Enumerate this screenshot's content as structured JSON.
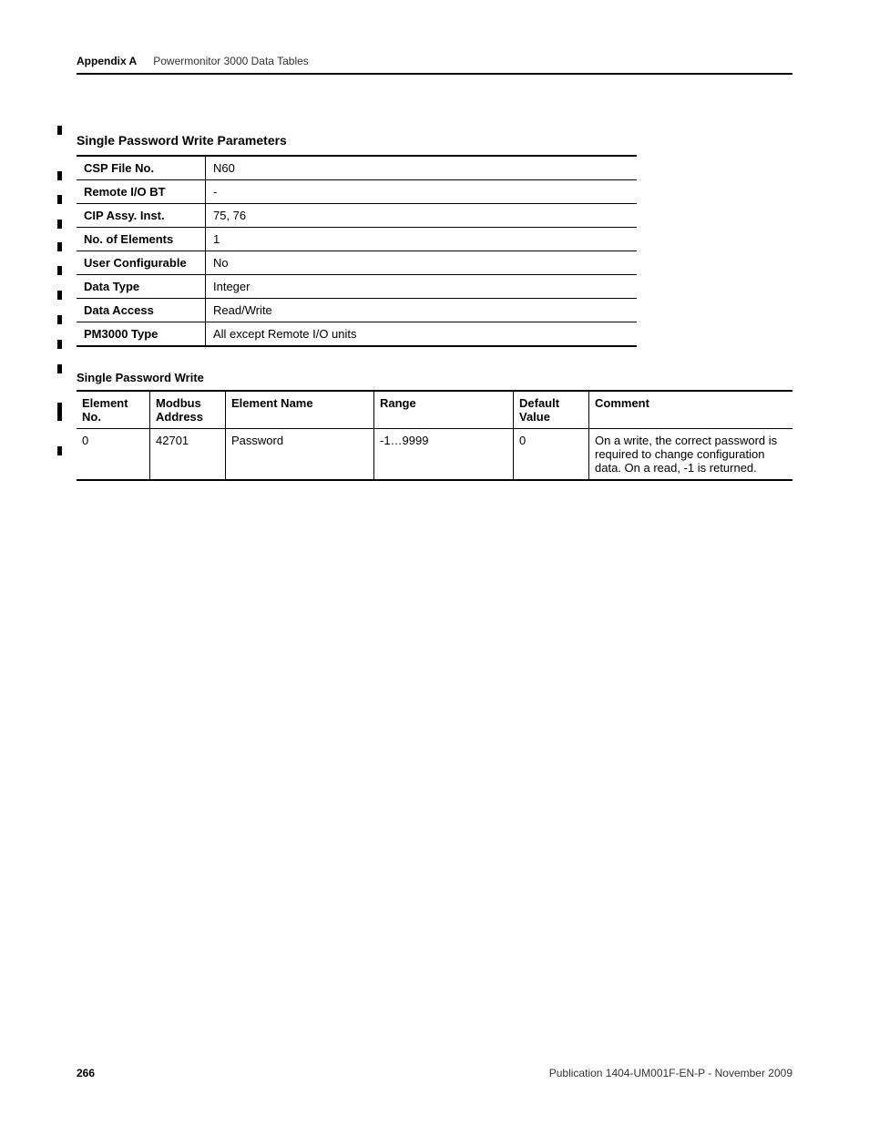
{
  "header": {
    "appendix": "Appendix A",
    "title": "Powermonitor 3000 Data Tables"
  },
  "section_title": "Single Password Write Parameters",
  "params": [
    {
      "label": "CSP File No.",
      "value": "N60"
    },
    {
      "label": "Remote I/O BT",
      "value": "-"
    },
    {
      "label": "CIP Assy. Inst.",
      "value": "75, 76"
    },
    {
      "label": "No. of Elements",
      "value": "1"
    },
    {
      "label": "User Configurable",
      "value": "No"
    },
    {
      "label": "Data Type",
      "value": "Integer"
    },
    {
      "label": "Data Access",
      "value": "Read/Write"
    },
    {
      "label": "PM3000 Type",
      "value": "All except Remote I/O units"
    }
  ],
  "sub_title": "Single Password Write",
  "table": {
    "headers": {
      "elno": "Element No.",
      "modbus": "Modbus Address",
      "elname": "Element Name",
      "range": "Range",
      "default": "Default Value",
      "comment": "Comment"
    },
    "rows": [
      {
        "elno": "0",
        "modbus": "42701",
        "elname": "Password",
        "range": "-1…9999",
        "default": "0",
        "comment": "On a write, the correct password is required to change configuration data. On a read, -1 is returned."
      }
    ]
  },
  "footer": {
    "page": "266",
    "pub": "Publication 1404-UM001F-EN-P - November 2009"
  }
}
